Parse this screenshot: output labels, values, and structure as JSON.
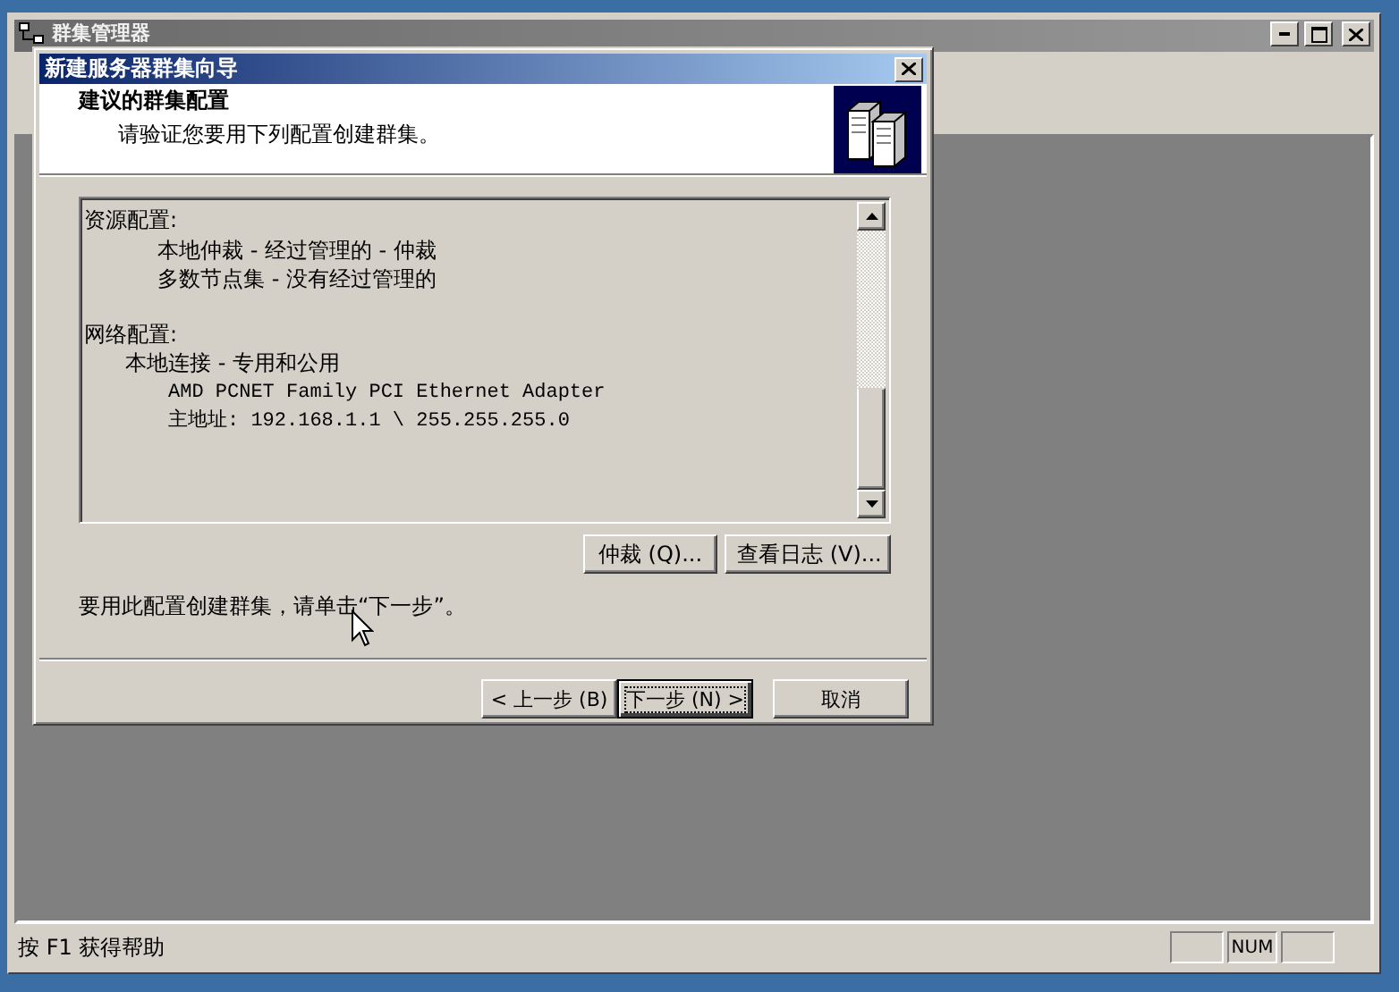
{
  "main_window": {
    "title": "群集管理器",
    "status_bar": {
      "text": "按 F1 获得帮助",
      "num_indicator": "NUM"
    }
  },
  "dialog": {
    "title": "新建服务器群集向导",
    "header": {
      "title": "建议的群集配置",
      "subtitle": "请验证您要用下列配置创建群集。"
    },
    "sections": [
      {
        "heading": "资源配置:",
        "lines": [
          {
            "kind": "deep",
            "text": "本地仲裁 - 经过管理的 - 仲裁"
          },
          {
            "kind": "deep",
            "text": "多数节点集 - 没有经过管理的"
          }
        ]
      },
      {
        "heading": "网络配置:",
        "lines": [
          {
            "kind": "item",
            "text": "本地连接 - 专用和公用"
          },
          {
            "kind": "detail",
            "text": "AMD PCNET Family PCI Ethernet Adapter"
          },
          {
            "kind": "detail",
            "text": "主地址: 192.168.1.1 \\ 255.255.255.0"
          }
        ]
      }
    ],
    "side_buttons": [
      "仲裁 (Q)...",
      "查看日志 (V)..."
    ],
    "instruction": "要用此配置创建群集，请单击“下一步”。",
    "nav_buttons": [
      {
        "label": "< 上一步 (B)",
        "default": false
      },
      {
        "label": "下一步 (N) >",
        "default": true
      },
      {
        "label": "取消",
        "default": false
      }
    ]
  }
}
